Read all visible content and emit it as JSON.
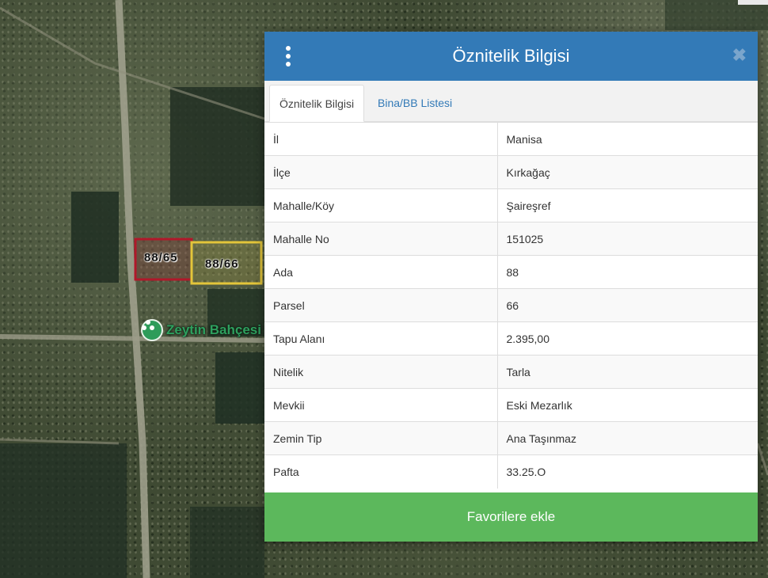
{
  "map": {
    "parcels": [
      {
        "label": "88/65",
        "color": "#b0182a",
        "state": "selected"
      },
      {
        "label": "88/66",
        "color": "#e3c53a",
        "state": "highlighted"
      }
    ],
    "poi": {
      "label": "Zeytin Bahçesi",
      "icon": "leaf-pin-icon"
    }
  },
  "dialog": {
    "title": "Öznitelik Bilgisi",
    "menu_icon": "kebab-menu-icon",
    "close_glyph": "✖",
    "tabs": [
      {
        "label": "Öznitelik Bilgisi",
        "active": true
      },
      {
        "label": "Bina/BB Listesi",
        "active": false
      }
    ],
    "rows": [
      {
        "key": "İl",
        "value": "Manisa"
      },
      {
        "key": "İlçe",
        "value": "Kırkağaç"
      },
      {
        "key": "Mahalle/Köy",
        "value": "Şaireşref"
      },
      {
        "key": "Mahalle No",
        "value": "151025"
      },
      {
        "key": "Ada",
        "value": "88"
      },
      {
        "key": "Parsel",
        "value": "66"
      },
      {
        "key": "Tapu Alanı",
        "value": "2.395,00"
      },
      {
        "key": "Nitelik",
        "value": "Tarla"
      },
      {
        "key": "Mevkii",
        "value": "Eski Mezarlık"
      },
      {
        "key": "Zemin Tip",
        "value": "Ana Taşınmaz"
      },
      {
        "key": "Pafta",
        "value": "33.25.O"
      }
    ],
    "favorite_button": "Favorilere ekle"
  },
  "colors": {
    "header": "#337ab7",
    "button": "#5cb85c",
    "tab_link": "#337ab7"
  }
}
